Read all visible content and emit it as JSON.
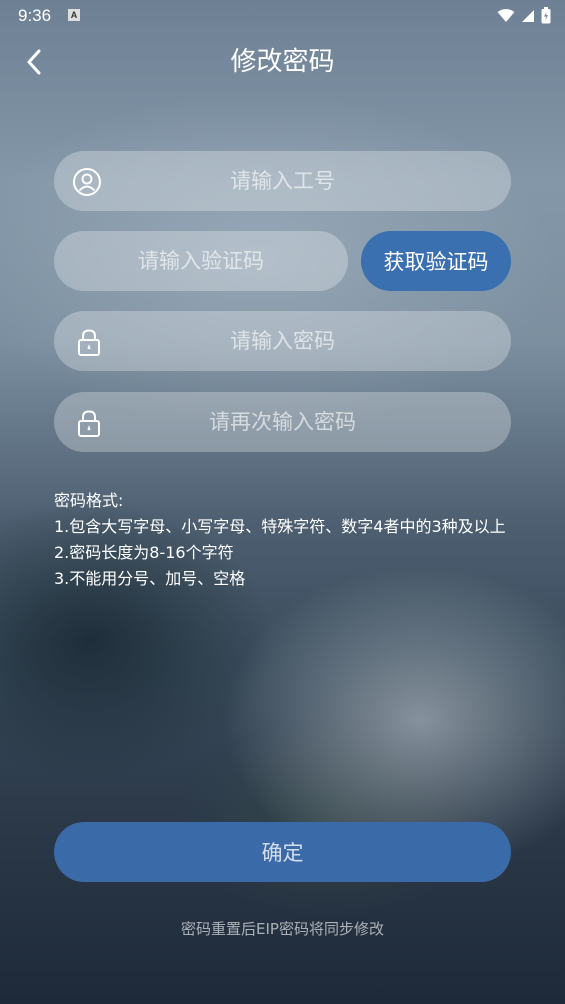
{
  "status_bar": {
    "time": "9:36",
    "app_icon_letter": "A",
    "icons": [
      "wifi-icon",
      "signal-icon",
      "battery-icon"
    ]
  },
  "header": {
    "title": "修改密码",
    "back_icon": "chevron-left-icon"
  },
  "form": {
    "employee_id": {
      "value": "",
      "placeholder": "请输入工号",
      "icon": "user-circle-icon"
    },
    "verification_code": {
      "value": "",
      "placeholder": "请输入验证码"
    },
    "get_code_label": "获取验证码",
    "password": {
      "value": "",
      "placeholder": "请输入密码",
      "icon": "lock-icon"
    },
    "confirm_password": {
      "value": "",
      "placeholder": "请再次输入密码",
      "icon": "lock-icon"
    }
  },
  "rules": {
    "heading": "密码格式:",
    "items": [
      "1.包含大写字母、小写字母、特殊字符、数字4者中的3种及以上",
      "2.密码长度为8-16个字符",
      "3.不能用分号、加号、空格"
    ]
  },
  "submit_label": "确定",
  "footer_note": "密码重置后EIP密码将同步修改",
  "colors": {
    "primary_button": "#3a6fb0",
    "field_bg": "rgba(255,255,255,0.28)"
  }
}
